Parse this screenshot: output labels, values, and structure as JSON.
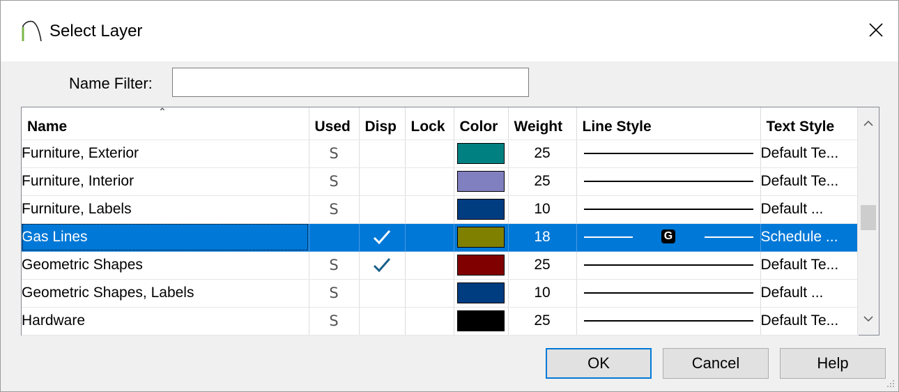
{
  "window": {
    "title": "Select Layer"
  },
  "filter": {
    "label": "Name Filter:",
    "value": ""
  },
  "columns": {
    "name": "Name",
    "used": "Used",
    "disp": "Disp",
    "lock": "Lock",
    "color": "Color",
    "weight": "Weight",
    "line_style": "Line Style",
    "text_style": "Text Style"
  },
  "rows": [
    {
      "name": "Furniture, Exterior",
      "used": "S",
      "disp": false,
      "lock": false,
      "color": "#008080",
      "weight": "25",
      "line_badge": "",
      "text_style": "Default Te...",
      "selected": false
    },
    {
      "name": "Furniture, Interior",
      "used": "S",
      "disp": false,
      "lock": false,
      "color": "#8080c0",
      "weight": "25",
      "line_badge": "",
      "text_style": "Default Te...",
      "selected": false
    },
    {
      "name": "Furniture, Labels",
      "used": "S",
      "disp": false,
      "lock": false,
      "color": "#003c80",
      "weight": "10",
      "line_badge": "",
      "text_style": "Default ...",
      "selected": false
    },
    {
      "name": "Gas Lines",
      "used": "",
      "disp": true,
      "lock": false,
      "color": "#808000",
      "weight": "18",
      "line_badge": "G",
      "text_style": "Schedule ...",
      "selected": true
    },
    {
      "name": "Geometric Shapes",
      "used": "S",
      "disp": true,
      "lock": false,
      "color": "#800000",
      "weight": "25",
      "line_badge": "",
      "text_style": "Default Te...",
      "selected": false
    },
    {
      "name": "Geometric Shapes, Labels",
      "used": "S",
      "disp": false,
      "lock": false,
      "color": "#003c80",
      "weight": "10",
      "line_badge": "",
      "text_style": "Default ...",
      "selected": false
    },
    {
      "name": "Hardware",
      "used": "S",
      "disp": false,
      "lock": false,
      "color": "#000000",
      "weight": "25",
      "line_badge": "",
      "text_style": "Default Te...",
      "selected": false
    }
  ],
  "buttons": {
    "ok": "OK",
    "cancel": "Cancel",
    "help": "Help"
  },
  "colors": {
    "selection": "#0078d7",
    "default_button_border": "#0078d7",
    "check": "#1a5f8a"
  }
}
